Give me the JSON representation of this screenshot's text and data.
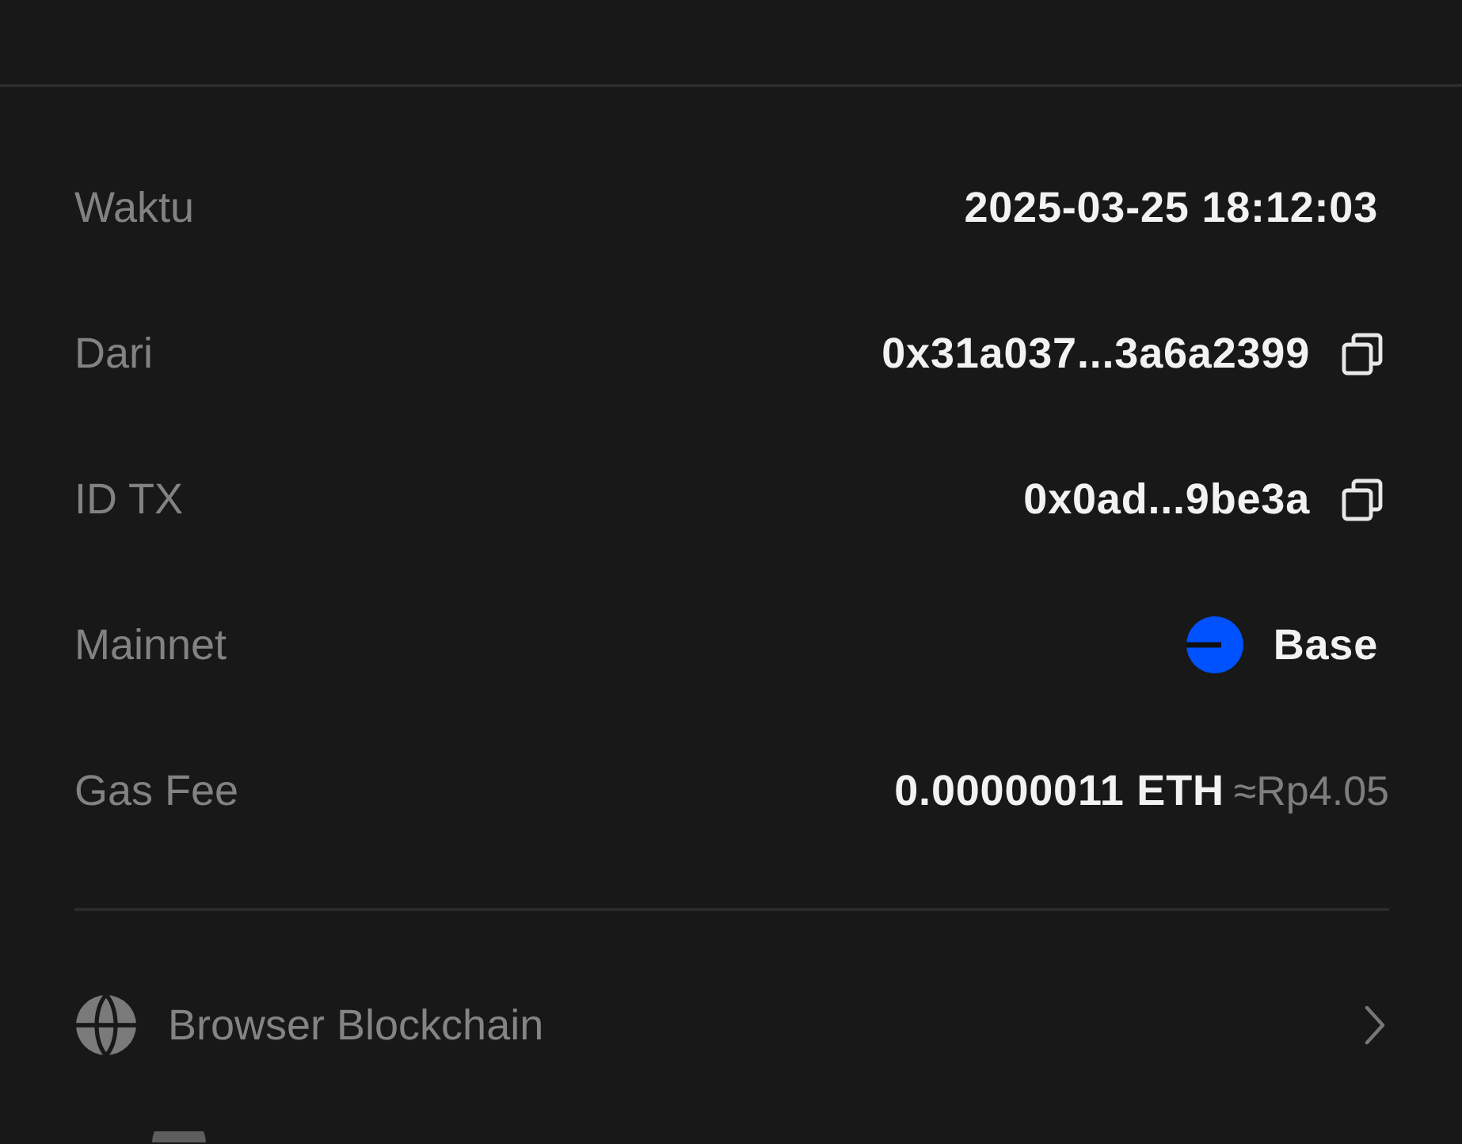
{
  "rows": [
    {
      "label": "Waktu",
      "kind": "text",
      "value": "2025-03-25 18:12:03"
    },
    {
      "label": "Dari",
      "kind": "copy",
      "value": "0x31a037...3a6a2399"
    },
    {
      "label": "ID TX",
      "kind": "copy",
      "value": "0x0ad...9be3a"
    },
    {
      "label": "Mainnet",
      "kind": "network",
      "value": "Base"
    },
    {
      "label": "Gas Fee",
      "kind": "fee",
      "value": "0.00000011 ETH",
      "approx": "≈Rp4.05"
    }
  ],
  "links": [
    {
      "label": "Browser Blockchain",
      "kind": "globe"
    }
  ]
}
